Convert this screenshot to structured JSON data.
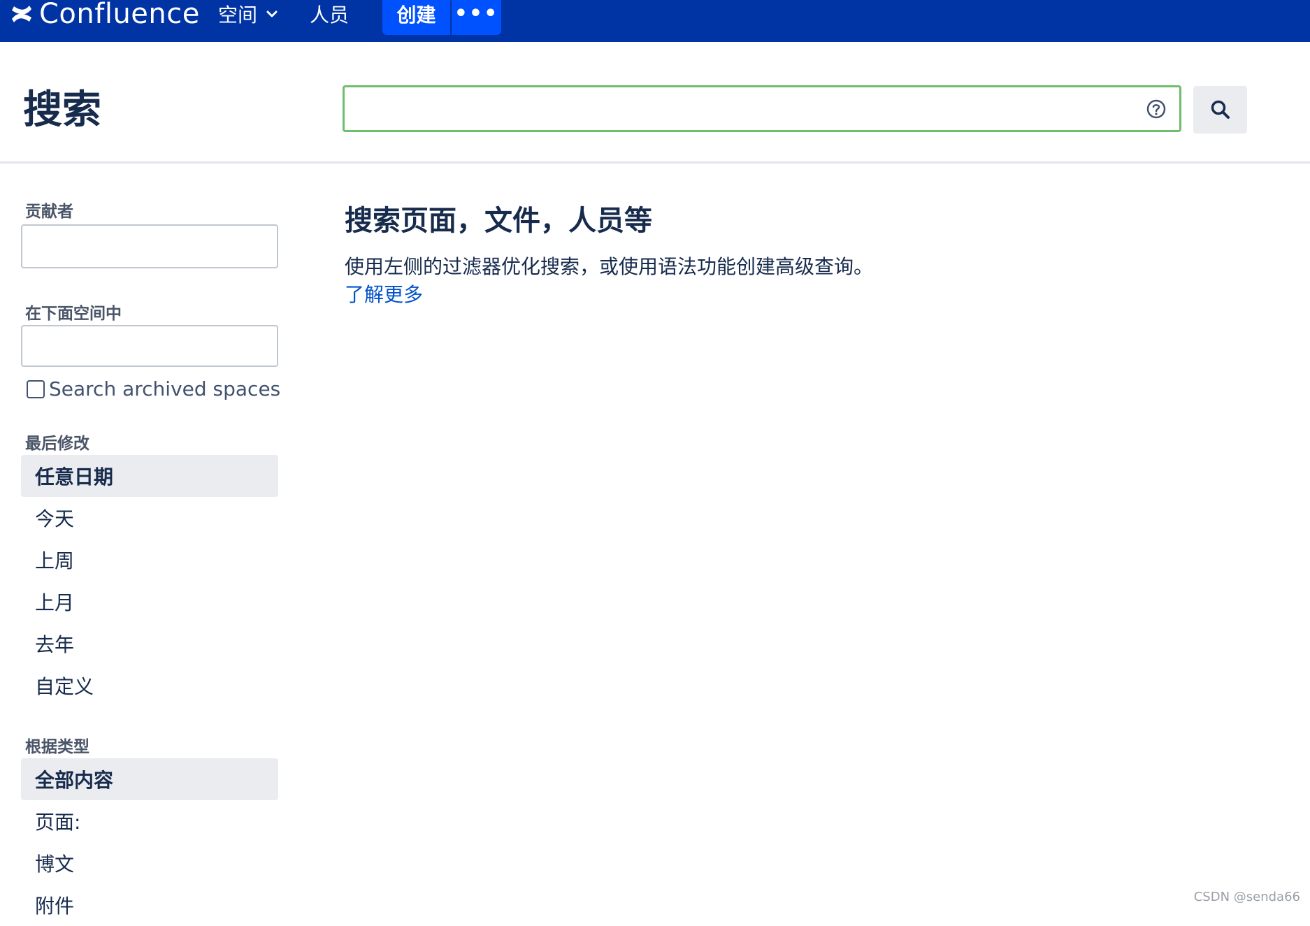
{
  "topnav": {
    "logo_text": "Confluence",
    "spaces_label": "空间",
    "people_label": "人员",
    "create_label": "创建",
    "more_label": "•••"
  },
  "header": {
    "title": "搜索",
    "search_value": "",
    "search_placeholder": ""
  },
  "sidebar": {
    "contributor_label": "贡献者",
    "space_label": "在下面空间中",
    "archived_label": "Search archived spaces",
    "archived_checked": false,
    "last_modified_label": "最后修改",
    "date_options": [
      "任意日期",
      "今天",
      "上周",
      "上月",
      "去年",
      "自定义"
    ],
    "date_selected": "任意日期",
    "type_label": "根据类型",
    "type_options": [
      "全部内容",
      "页面:",
      "博文",
      "附件"
    ],
    "type_selected": "全部内容"
  },
  "main": {
    "title": "搜索页面，文件，人员等",
    "description": "使用左侧的过滤器优化搜索，或使用语法功能创建高级查询。",
    "learn_more": "了解更多"
  },
  "watermark": "CSDN @senda66",
  "colors": {
    "nav_bg": "#0033a3",
    "create_bg": "#0052ff",
    "focus_border": "#6fbe6c",
    "link": "#0052cc",
    "selected_bg": "#ebecf0"
  }
}
